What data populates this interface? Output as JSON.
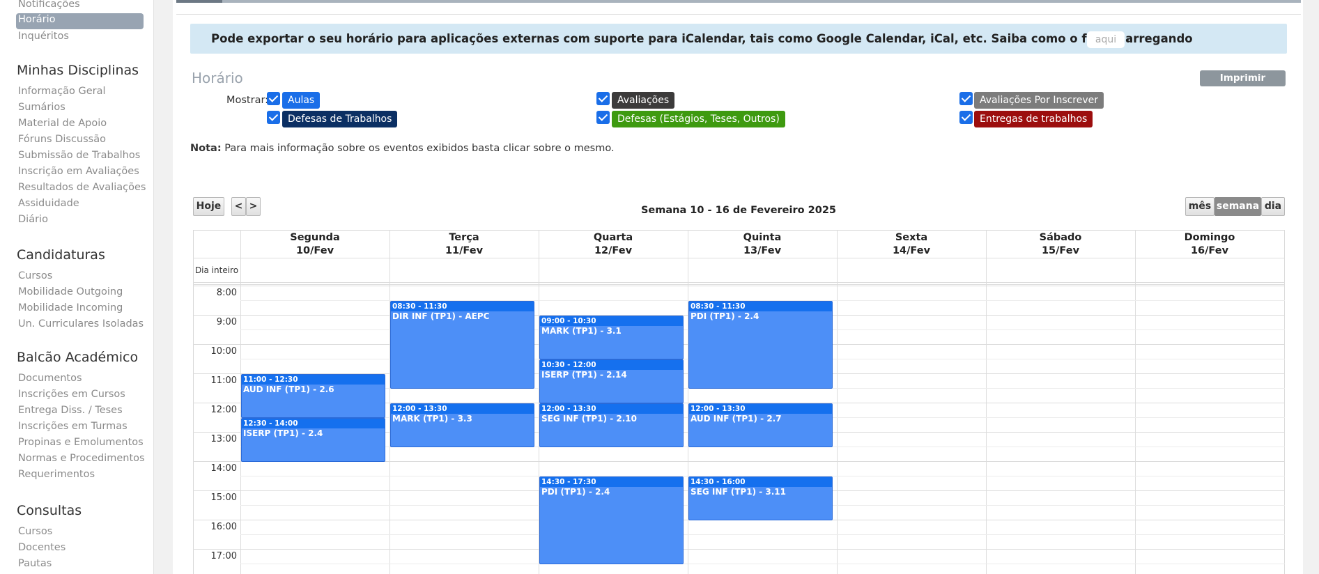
{
  "sidebar": {
    "top_items": [
      "Notificações",
      "Horário",
      "Inquéritos"
    ],
    "sections": [
      {
        "title": "Minhas Disciplinas",
        "items": [
          "Informação Geral",
          "Sumários",
          "Material de Apoio",
          "Fóruns Discussão",
          "Submissão de Trabalhos",
          "Inscrição em Avaliações",
          "Resultados de Avaliações",
          "Assiduidade",
          "Diário"
        ]
      },
      {
        "title": "Candidaturas",
        "items": [
          "Cursos",
          "Mobilidade Outgoing",
          "Mobilidade Incoming",
          "Un. Curriculares Isoladas"
        ]
      },
      {
        "title": "Balcão Académico",
        "items": [
          "Documentos",
          "Inscrições em Cursos",
          "Entrega Diss. / Teses",
          "Inscrições em Turmas",
          "Propinas e Emolumentos",
          "Normas e Procedimentos",
          "Requerimentos"
        ]
      },
      {
        "title": "Consultas",
        "items": [
          "Cursos",
          "Docentes",
          "Pautas"
        ]
      }
    ]
  },
  "ical": {
    "text": "Pode exportar o seu horário para aplicações externas com suporte para iCalendar, tais como Google Calendar, iCal, etc. Saiba como o fazer carregando",
    "link": "aqui",
    "trail": "."
  },
  "page": {
    "title": "Horário",
    "print_button": "Imprimir Horário",
    "show_label": "Mostrar:",
    "filters": [
      {
        "label": "Aulas",
        "color": "#1a6ee8"
      },
      {
        "label": "Avaliações",
        "color": "#3c3b3b"
      },
      {
        "label": "Avaliações Por Inscrever",
        "color": "#7c7c7c"
      },
      {
        "label": "Defesas de Trabalhos",
        "color": "#0b2f63"
      },
      {
        "label": "Defesas (Estágios, Teses, Outros)",
        "color": "#3e9a10"
      },
      {
        "label": "Entregas de trabalhos",
        "color": "#9c0e0e"
      }
    ],
    "note_bold": "Nota:",
    "note_text": " Para mais informação sobre os eventos exibidos basta clicar sobre o mesmo."
  },
  "calendar": {
    "today_button": "Hoje",
    "prev": "<",
    "next": ">",
    "week_title": "Semana 10 - 16 de Fevereiro 2025",
    "views": [
      "mês",
      "semana",
      "dia"
    ],
    "active_view": "semana",
    "all_day_label": "Dia inteiro",
    "days": [
      {
        "name": "Segunda",
        "date": "10/Fev"
      },
      {
        "name": "Terça",
        "date": "11/Fev"
      },
      {
        "name": "Quarta",
        "date": "12/Fev"
      },
      {
        "name": "Quinta",
        "date": "13/Fev"
      },
      {
        "name": "Sexta",
        "date": "14/Fev"
      },
      {
        "name": "Sábado",
        "date": "15/Fev"
      },
      {
        "name": "Domingo",
        "date": "16/Fev"
      }
    ],
    "hours": [
      "8:00",
      "9:00",
      "10:00",
      "11:00",
      "12:00",
      "13:00",
      "14:00",
      "15:00",
      "16:00",
      "17:00"
    ],
    "events": [
      {
        "day": 0,
        "start": "11:00",
        "end": "12:30",
        "time": "11:00 - 12:30",
        "title": "AUD INF (TP1) - 2.6"
      },
      {
        "day": 0,
        "start": "12:30",
        "end": "14:00",
        "time": "12:30 - 14:00",
        "title": "ISERP (TP1) - 2.4"
      },
      {
        "day": 1,
        "start": "08:30",
        "end": "11:30",
        "time": "08:30 - 11:30",
        "title": "DIR INF (TP1) - AEPC"
      },
      {
        "day": 1,
        "start": "12:00",
        "end": "13:30",
        "time": "12:00 - 13:30",
        "title": "MARK (TP1) - 3.3"
      },
      {
        "day": 2,
        "start": "09:00",
        "end": "10:30",
        "time": "09:00 - 10:30",
        "title": "MARK (TP1) - 3.1"
      },
      {
        "day": 2,
        "start": "10:30",
        "end": "12:00",
        "time": "10:30 - 12:00",
        "title": "ISERP (TP1) - 2.14"
      },
      {
        "day": 2,
        "start": "12:00",
        "end": "13:30",
        "time": "12:00 - 13:30",
        "title": "SEG INF (TP1) - 2.10"
      },
      {
        "day": 2,
        "start": "14:30",
        "end": "17:30",
        "time": "14:30 - 17:30",
        "title": "PDI (TP1) - 2.4"
      },
      {
        "day": 3,
        "start": "08:30",
        "end": "11:30",
        "time": "08:30 - 11:30",
        "title": "PDI (TP1) - 2.4"
      },
      {
        "day": 3,
        "start": "12:00",
        "end": "13:30",
        "time": "12:00 - 13:30",
        "title": "AUD INF (TP1) - 2.7"
      },
      {
        "day": 3,
        "start": "14:30",
        "end": "16:00",
        "time": "14:30 - 16:00",
        "title": "SEG INF (TP1) - 3.11"
      }
    ]
  }
}
